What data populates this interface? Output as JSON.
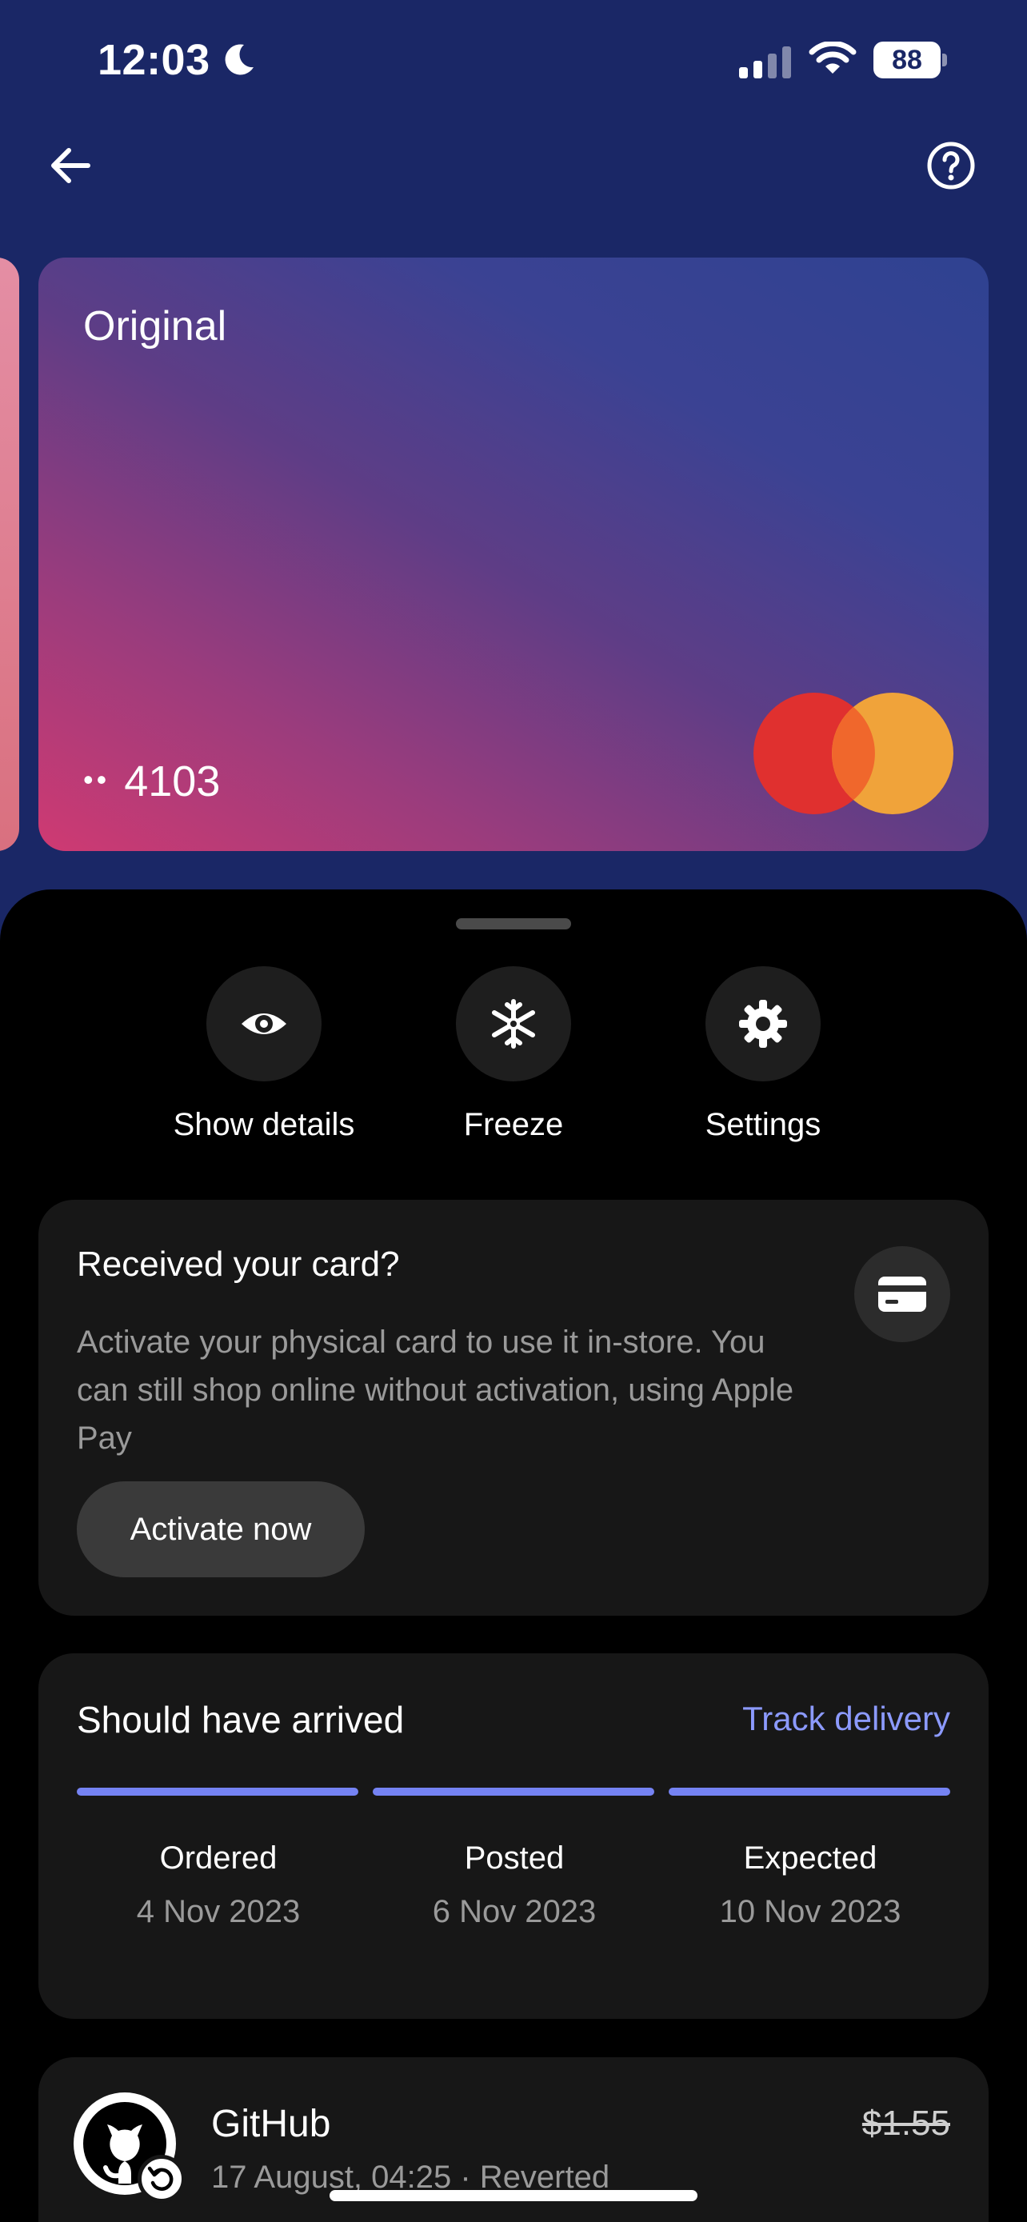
{
  "status_bar": {
    "time": "12:03",
    "battery": "88",
    "icons": [
      "moon-icon",
      "cellular-signal-icon",
      "wifi-icon",
      "battery-icon"
    ]
  },
  "nav": {
    "back_icon": "arrow-left-icon",
    "help_icon": "question-circle-icon"
  },
  "card": {
    "name": "Original",
    "masked_dots": "••",
    "last4": "4103",
    "network_icon": "mastercard-logo-icon",
    "colors": {
      "gradient_start": "#cf3a72",
      "gradient_end": "#2f4291"
    }
  },
  "actions": [
    {
      "label": "Show details",
      "icon": "eye-icon"
    },
    {
      "label": "Freeze",
      "icon": "snowflake-icon"
    },
    {
      "label": "Settings",
      "icon": "gear-icon"
    }
  ],
  "activate": {
    "title": "Received your card?",
    "description": "Activate your physical card to use it in-store. You can still shop online without activation, using Apple Pay",
    "button_label": "Activate now",
    "icon": "card-icon"
  },
  "delivery": {
    "title": "Should have arrived",
    "track_label": "Track delivery",
    "accent": "#7583f3",
    "progress": [
      1,
      1,
      1
    ],
    "steps": [
      {
        "label": "Ordered",
        "date": "4 Nov 2023"
      },
      {
        "label": "Posted",
        "date": "6 Nov 2023"
      },
      {
        "label": "Expected",
        "date": "10 Nov 2023"
      }
    ]
  },
  "transaction": {
    "merchant": "GitHub",
    "meta": "17 August, 04:25 · Reverted",
    "amount": "$1.55",
    "logo_icon": "github-logo-icon",
    "badge_icon": "revert-icon"
  }
}
